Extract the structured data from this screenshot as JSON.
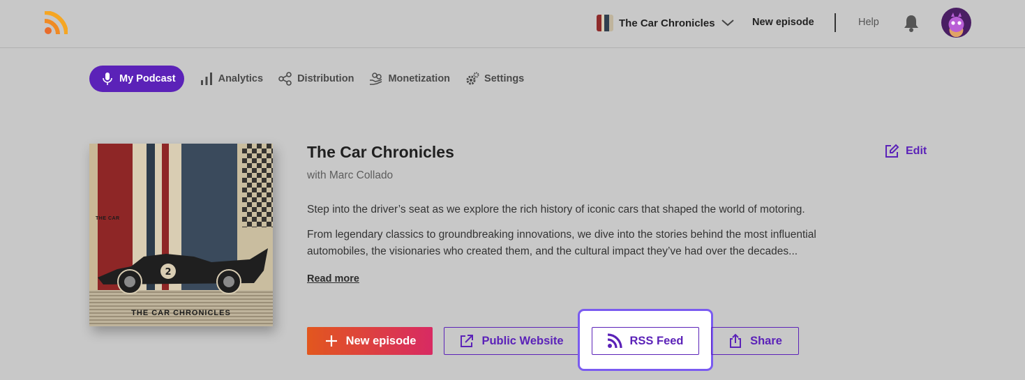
{
  "header": {
    "show_name": "The Car Chronicles",
    "new_episode_label": "New episode",
    "help_label": "Help"
  },
  "tabs": [
    {
      "label": "My Podcast",
      "active": true
    },
    {
      "label": "Analytics"
    },
    {
      "label": "Distribution"
    },
    {
      "label": "Monetization"
    },
    {
      "label": "Settings"
    }
  ],
  "podcast": {
    "cover_small_text": "THE CAR",
    "cover_title": "THE CAR CHRONICLES",
    "cover_badge": "2",
    "title": "The Car Chronicles",
    "host": "with Marc Collado",
    "edit_label": "Edit",
    "description_1": "Step into the driver’s seat as we explore the rich history of iconic cars that shaped the world of motoring.",
    "description_2": "From legendary classics to groundbreaking innovations, we dive into the stories behind the most influential automobiles, the visionaries who created them, and the cultural impact they’ve had over the decades...",
    "read_more_label": "Read more"
  },
  "actions": {
    "new_episode": "New episode",
    "public_website": "Public Website",
    "rss_feed": "RSS Feed",
    "share": "Share"
  },
  "colors": {
    "accent": "#5b22b8",
    "highlight": "#7a5bf0",
    "primary_gradient_start": "#e2571e",
    "primary_gradient_end": "#d82a63",
    "logo_orange": "#f08a24"
  },
  "icons": [
    "rss-logo-icon",
    "chevron-down-icon",
    "bell-icon",
    "microphone-icon",
    "bar-chart-icon",
    "share-nodes-icon",
    "hand-coins-icon",
    "gear-icon",
    "edit-icon",
    "plus-icon",
    "external-link-icon",
    "rss-icon",
    "share-upload-icon"
  ]
}
